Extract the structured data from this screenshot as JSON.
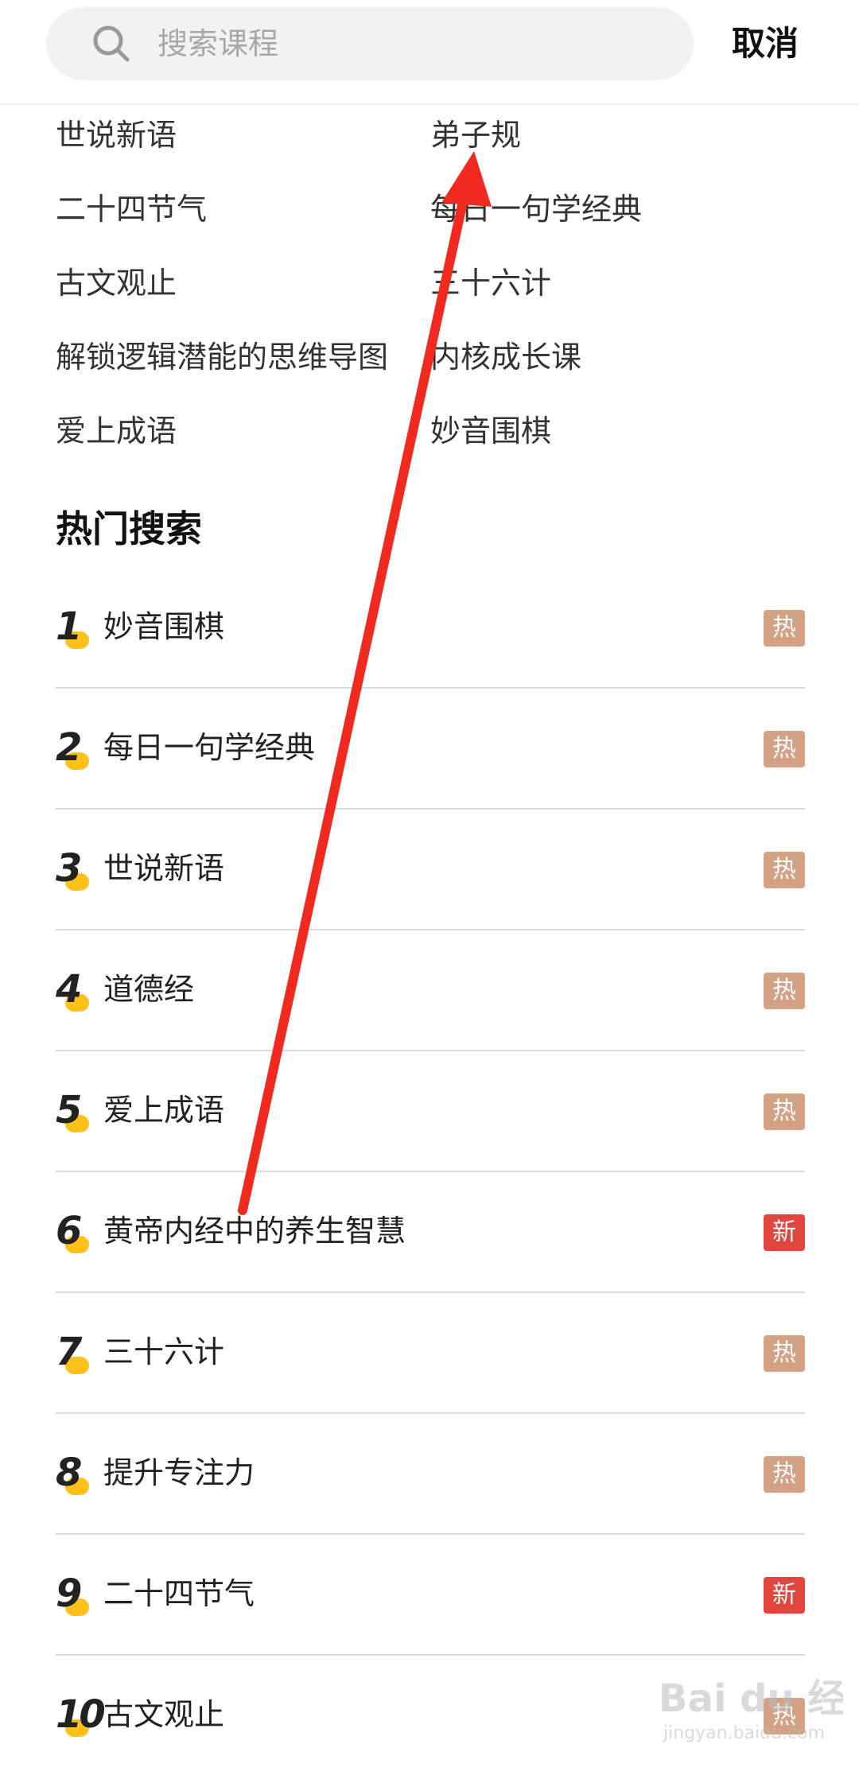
{
  "search": {
    "placeholder": "搜索课程",
    "cancel_label": "取消"
  },
  "recent": {
    "items": [
      {
        "label": "世说新语"
      },
      {
        "label": "弟子规"
      },
      {
        "label": "二十四节气"
      },
      {
        "label": "每日一句学经典"
      },
      {
        "label": "古文观止"
      },
      {
        "label": "三十六计"
      },
      {
        "label": "解锁逻辑潜能的思维导图"
      },
      {
        "label": "内核成长课"
      },
      {
        "label": "爱上成语"
      },
      {
        "label": "妙音围棋"
      }
    ]
  },
  "hot": {
    "title": "热门搜索",
    "items": [
      {
        "rank": "1",
        "title": "妙音围棋",
        "badge": "热",
        "badge_type": "hot"
      },
      {
        "rank": "2",
        "title": "每日一句学经典",
        "badge": "热",
        "badge_type": "hot"
      },
      {
        "rank": "3",
        "title": "世说新语",
        "badge": "热",
        "badge_type": "hot"
      },
      {
        "rank": "4",
        "title": "道德经",
        "badge": "热",
        "badge_type": "hot"
      },
      {
        "rank": "5",
        "title": "爱上成语",
        "badge": "热",
        "badge_type": "hot"
      },
      {
        "rank": "6",
        "title": "黄帝内经中的养生智慧",
        "badge": "新",
        "badge_type": "new"
      },
      {
        "rank": "7",
        "title": "三十六计",
        "badge": "热",
        "badge_type": "hot"
      },
      {
        "rank": "8",
        "title": "提升专注力",
        "badge": "热",
        "badge_type": "hot"
      },
      {
        "rank": "9",
        "title": "二十四节气",
        "badge": "新",
        "badge_type": "new"
      },
      {
        "rank": "10",
        "title": "古文观止",
        "badge": "热",
        "badge_type": "hot"
      }
    ]
  },
  "colors": {
    "hot_badge": "#d3a285",
    "new_badge": "#e0463e",
    "rank_accent": "#ffc21a",
    "annotation": "#f02a1e"
  },
  "watermark": {
    "brand": "Bai du 经验",
    "url": "jingyan.baidu.com"
  }
}
